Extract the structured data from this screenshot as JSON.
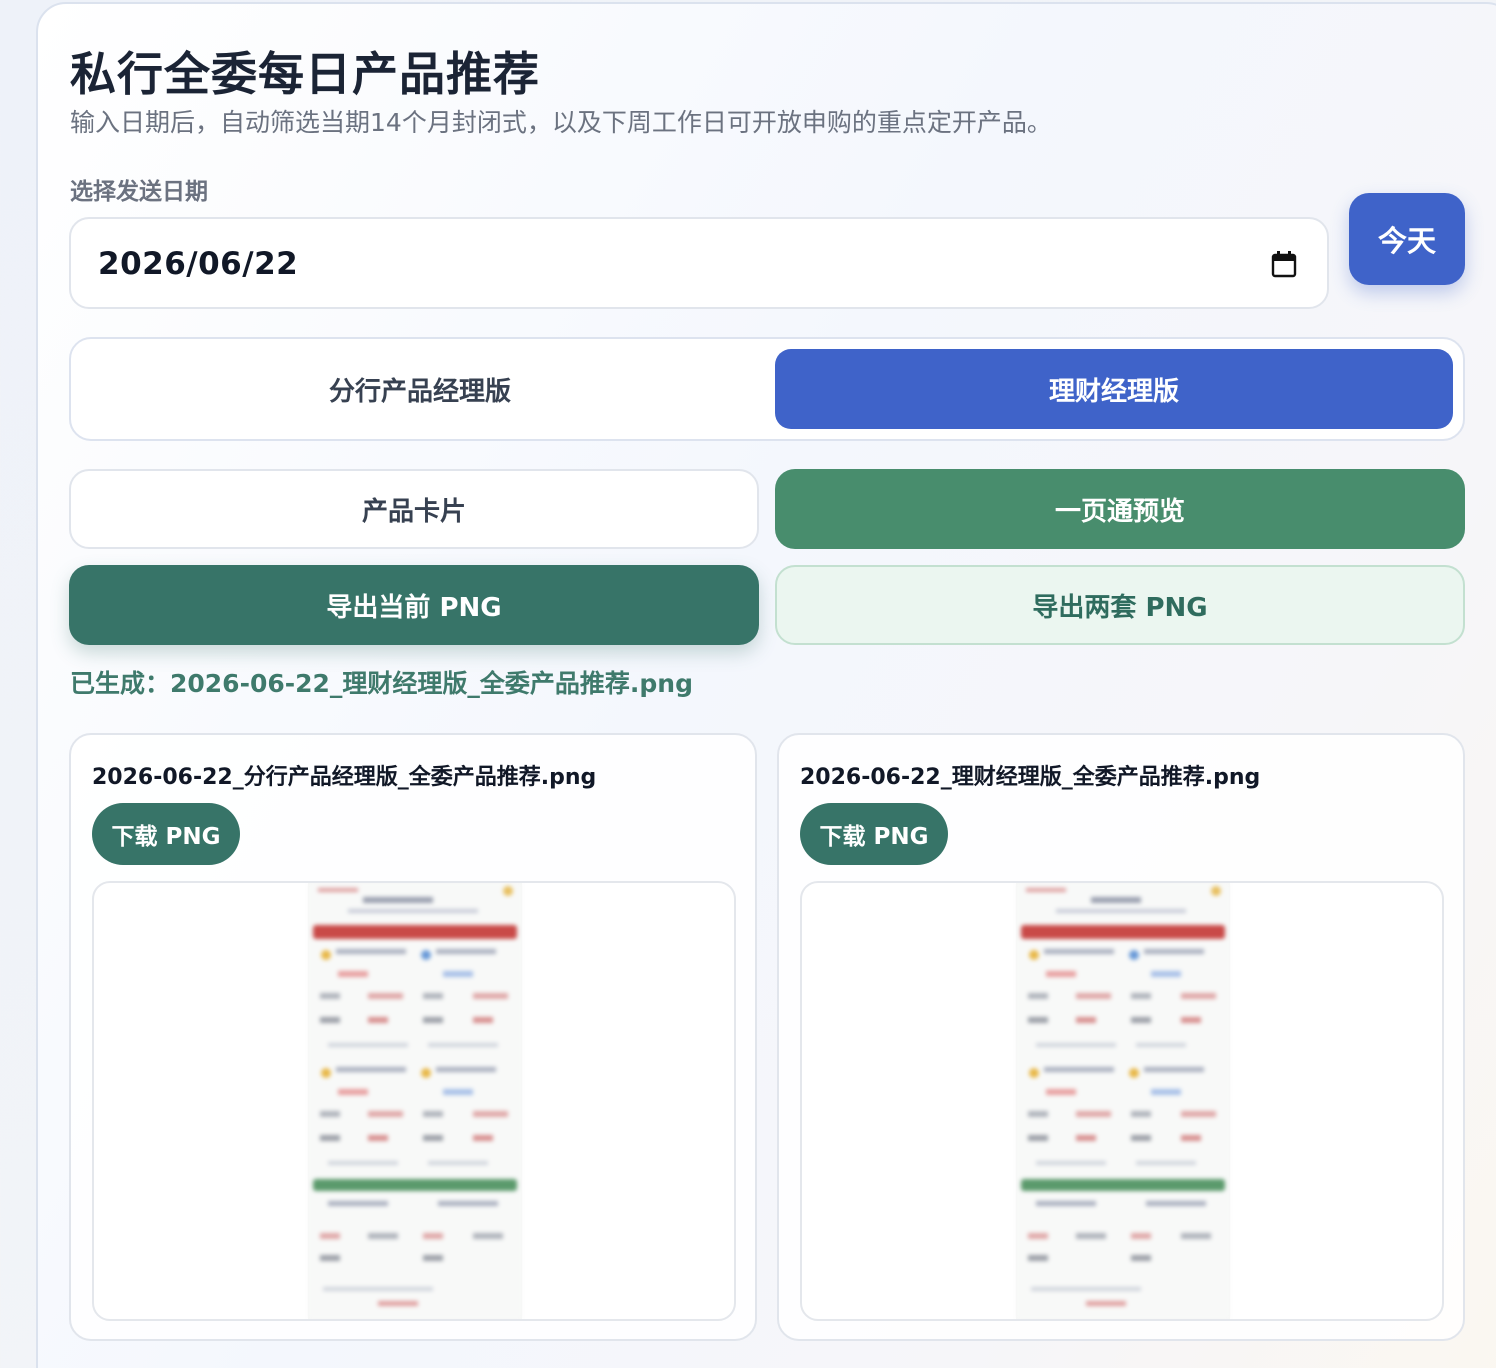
{
  "header": {
    "title": "私行全委每日产品推荐",
    "subtitle": "输入日期后，自动筛选当期14个月封闭式，以及下周工作日可开放申购的重点定开产品。"
  },
  "date_picker": {
    "label": "选择发送日期",
    "value": "2026/06/22",
    "today_label": "今天"
  },
  "mode_switch": {
    "options": [
      {
        "label": "分行产品经理版",
        "selected": false
      },
      {
        "label": "理财经理版",
        "selected": true
      }
    ]
  },
  "view_buttons": {
    "card_label": "产品卡片",
    "onepage_label": "一页通预览"
  },
  "export_buttons": {
    "current_label": "导出当前 PNG",
    "both_label": "导出两套 PNG"
  },
  "status": {
    "text": "已生成：2026-06-22_理财经理版_全委产品推荐.png"
  },
  "results": [
    {
      "file_name": "2026-06-22_分行产品经理版_全委产品推荐.png",
      "download_label": "下载 PNG"
    },
    {
      "file_name": "2026-06-22_理财经理版_全委产品推荐.png",
      "download_label": "下载 PNG"
    }
  ],
  "colors": {
    "primary_blue": "#3f63c9",
    "green": "#488d6d",
    "dark_green": "#377468",
    "light_green_bg": "#ebf6f0"
  }
}
